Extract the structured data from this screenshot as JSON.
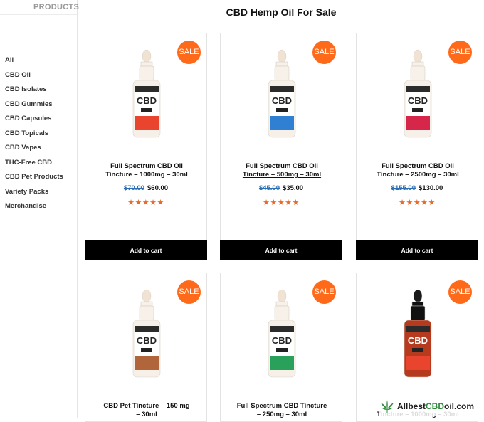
{
  "sidebar": {
    "heading": "PRODUCTS",
    "categories": [
      "All",
      "CBD Oil",
      "CBD Isolates",
      "CBD Gummies",
      "CBD Capsules",
      "CBD Topicals",
      "CBD Vapes",
      "THC-Free CBD",
      "CBD Pet Products",
      "Variety Packs",
      "Merchandise"
    ]
  },
  "page": {
    "title": "CBD Hemp Oil For Sale"
  },
  "products": [
    {
      "badge": "SALE",
      "name_line1": "Full Spectrum CBD Oil",
      "name_line2": "Tincture – 1000mg – 30ml",
      "old_price": "$70.00",
      "price": "$60.00",
      "rating": 5,
      "cart_label": "Add to cart",
      "label_color": "#e8442e",
      "bottle_type": "white-dropper",
      "bottle_text": "CBD",
      "bottle_sub": "OIL"
    },
    {
      "badge": "SALE",
      "name_line1": "Full Spectrum CBD Oil",
      "name_line2": "Tincture – 500mg – 30ml",
      "old_price": "$45.00",
      "price": "$35.00",
      "rating": 4.5,
      "cart_label": "Add to cart",
      "label_color": "#2f7fd3",
      "bottle_type": "white-dropper",
      "bottle_text": "CBD",
      "bottle_sub": "OIL"
    },
    {
      "badge": "SALE",
      "name_line1": "Full Spectrum CBD Oil",
      "name_line2": "Tincture – 2500mg – 30ml",
      "old_price": "$155.00",
      "price": "$130.00",
      "rating": 5,
      "cart_label": "Add to cart",
      "label_color": "#d6264a",
      "bottle_type": "white-dropper",
      "bottle_text": "CBD",
      "bottle_sub": "OIL"
    },
    {
      "badge": "SALE",
      "name_line1": "CBD Pet Tincture – 150 mg",
      "name_line2": "– 30ml",
      "old_price": "",
      "price": "",
      "rating": 0,
      "cart_label": "",
      "label_color": "#b0653a",
      "bottle_type": "white-dropper",
      "bottle_text": "CBD",
      "bottle_sub": "PET"
    },
    {
      "badge": "SALE",
      "name_line1": "Full Spectrum CBD Tincture",
      "name_line2": "– 250mg – 30ml",
      "old_price": "",
      "price": "",
      "rating": 0,
      "cart_label": "",
      "label_color": "#2aa15a",
      "bottle_type": "white-dropper",
      "bottle_text": "CBD",
      "bottle_sub": "OIL"
    },
    {
      "badge": "SALE",
      "name_line1": "",
      "name_line2": "Tincture – 1000mg – 30ml",
      "old_price": "",
      "price": "",
      "rating": 0,
      "cart_label": "",
      "label_color": "#e8442e",
      "bottle_type": "black-dropper",
      "bottle_text": "CBD",
      "bottle_sub": "CBD ISOLATE"
    }
  ],
  "watermark": {
    "part1": "Allbest",
    "part2": "CBD",
    "part3": "oil.com"
  },
  "colors": {
    "sale_badge": "#ff6a1a",
    "old_price": "#2a6fb3",
    "stars": "#e96b2c",
    "button": "#000000"
  }
}
